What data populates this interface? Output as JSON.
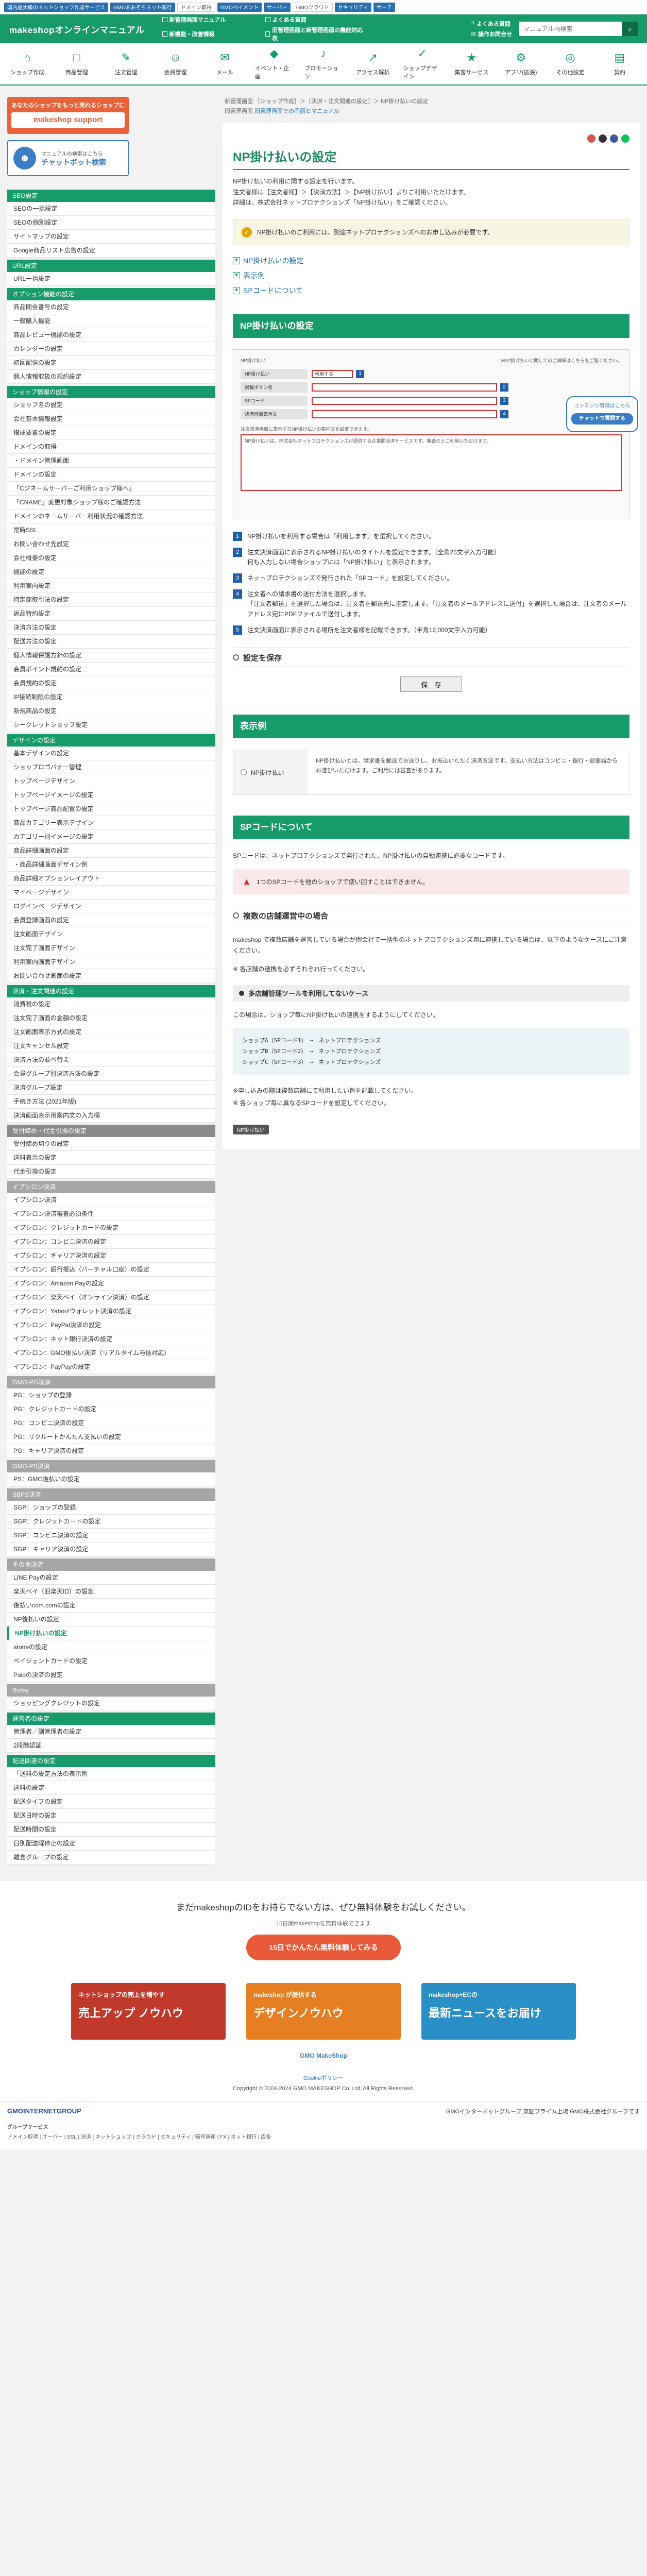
{
  "topbar": [
    "国内最大級のネットショップ作成サービス",
    "GMOあおぞらネット銀行",
    "ドメイン取得",
    "GMOペイメント",
    "サーバー",
    "GMOクラウド",
    "セキュリティ",
    "サーチ"
  ],
  "brand": "makeshopオンラインマニュアル",
  "news": [
    "新管理画面マニュアル",
    "よくある質問",
    "新機能・改善情報",
    "旧管理画面と新管理画面の機能対応表"
  ],
  "help": [
    "よくある質問",
    "操作お問合せ"
  ],
  "search_placeholder": "マニュアル内検索",
  "nav": [
    {
      "icon": "⌂",
      "label": "ショップ作成"
    },
    {
      "icon": "□",
      "label": "商品管理"
    },
    {
      "icon": "✎",
      "label": "注文管理"
    },
    {
      "icon": "☺",
      "label": "会員管理"
    },
    {
      "icon": "✉",
      "label": "メール"
    },
    {
      "icon": "◆",
      "label": "イベント・企画"
    },
    {
      "icon": "♪",
      "label": "プロモーション"
    },
    {
      "icon": "↗",
      "label": "アクセス解析"
    },
    {
      "icon": "✓",
      "label": "ショップデザイン"
    },
    {
      "icon": "★",
      "label": "集客サービス"
    },
    {
      "icon": "⚙",
      "label": "アプリ(拡張)"
    },
    {
      "icon": "◎",
      "label": "その他設定"
    },
    {
      "icon": "▤",
      "label": "契約"
    }
  ],
  "promo": {
    "line1": "あなたのショップをもっと売れるショップに",
    "line2": "makeshop support"
  },
  "chatbot": {
    "line1": "マニュアルの検索はこちら",
    "line2": "チャットボット検索"
  },
  "sidebar": [
    {
      "head": "SEO設定",
      "style": "green",
      "items": [
        "SEOの一括設定",
        "SEOの個別設定",
        "サイトマップの設定",
        "Google商品リスト広告の設定"
      ]
    },
    {
      "head": "URL設定",
      "style": "green",
      "items": [
        "URL一括設定"
      ]
    },
    {
      "head": "オプション機能の設定",
      "style": "green",
      "items": [
        "商品問合番号の設定",
        "一般購入機能",
        "商品レビュー機能の設定",
        "カレンダーの設定",
        "初回配信の設定",
        "個人情報取扱の規約設定"
      ]
    },
    {
      "head": "ショップ情報の設定",
      "style": "green",
      "items": [
        "ショップ名の設定",
        "会社基本情報設定",
        "構成要素の設定",
        "ドメインの取得",
        "・ドメイン管理画面",
        "ドメインの設定",
        "「Cジネームサーバーご利用ショップ様へ」",
        "「CNAME」変更対象ショップ様のご確認方法",
        "ドメインのネームサーバー利用状況の確認方法",
        "常時SSL",
        "お問い合わせ先設定",
        "会社概要の設定",
        "機能の設定",
        "利用案内設定",
        "特定商取引法の設定",
        "返品特約設定",
        "決済方法の設定",
        "配送方法の設定",
        "個人情報保護方針の設定",
        "会員ポイント規約の設定",
        "会員規約の設定",
        "IP接続制限の設定",
        "新規商品の設定",
        "シークレットショップ設定"
      ]
    },
    {
      "head": "デザインの設定",
      "style": "green",
      "items": [
        "基本デザインの設定",
        "ショップロゴバナー管理",
        "トップページデザイン",
        "トップページイメージの設定",
        "トップページ商品配置の設定",
        "商品カテゴリー表示デザイン",
        "カテゴリー別イメージの設定",
        "商品詳細画面の設定",
        "・商品詳細画面デザイン例",
        "商品詳細オプションレイアウト",
        "マイページデザイン",
        "ログインページデザイン",
        "会員登録画面の設定",
        "注文画面デザイン",
        "注文完了画面デザイン",
        "利用案内画面デザイン",
        "お問い合わせ画面の設定"
      ]
    },
    {
      "head": "決済・注文関連の設定",
      "style": "green",
      "items": [
        "消費税の設定",
        "注文完了画面の金額の設定",
        "注文画面表示方式の設定",
        "注文キャンセル設定",
        "決済方法の並べ替え",
        "会員グループ別決済方法の設定",
        "決済グループ設定",
        "手続き方法 (2021年版)",
        "決済画面表示用案内文の入力欄"
      ]
    },
    {
      "head": "受付締め・代金引換の設定",
      "style": "gray",
      "items": [
        "受付締め切りの設定",
        "送料表示の設定",
        "代金引換の設定"
      ]
    },
    {
      "head": "イプシロン決済",
      "style": "sub",
      "items": [
        "イプシロン決済",
        "イプシロン決済審査必須条件",
        "イプシロン：クレジットカードの設定",
        "イプシロン：コンビニ決済の設定",
        "イプシロン：キャリア決済の設定",
        "イプシロン：銀行振込（バーチャル口座）の設定",
        "イプシロン：Amazon Payの設定",
        "イプシロン：楽天ペイ（オンライン決済）の設定",
        "イプシロン：Yahoo!ウォレット決済の設定",
        "イプシロン：PayPal決済の設定",
        "イプシロン：ネット銀行決済の設定",
        "イプシロン：GMO後払い決済（リアルタイム与信対応）",
        "イプシロン：PayPayの設定"
      ]
    },
    {
      "head": "GMO-PG決済",
      "style": "sub",
      "items": [
        "PG：ショップの登録",
        "PG：クレジットカードの設定",
        "PG：コンビニ決済の設定",
        "PG：リクルートかんたん支払いの設定",
        "PG：キャリア決済の設定"
      ]
    },
    {
      "head": "GMO-PS決済",
      "style": "sub",
      "items": [
        "PS：GMO後払いの設定"
      ]
    },
    {
      "head": "SBPS決済",
      "style": "sub",
      "items": [
        "SGP：ショップの登録",
        "SGP：クレジットカードの設定",
        "SGP：コンビニ決済の設定",
        "SGP：キャリア決済の設定"
      ]
    },
    {
      "head": "その他決済",
      "style": "sub",
      "items": [
        "LINE Payの設定",
        "楽天ペイ（旧楽天ID）の設定",
        "後払いcom.comの設定",
        "NP後払いの設定",
        "NP掛け払いの設定",
        "atoneの設定",
        "ペイジェントカードの設定",
        "Paidの決済の設定"
      ]
    },
    {
      "head": "Bizley",
      "style": "sub",
      "items": [
        "ショッピングクレジットの設定"
      ]
    },
    {
      "head": "運営者の設定",
      "style": "green",
      "items": [
        "管理者／副管理者の設定",
        "2段階認証"
      ]
    },
    {
      "head": "配送関連の設定",
      "style": "green",
      "items": [
        "「送料の設定方法の表示例",
        "送料の設定",
        "配送タイプの設定",
        "配送日時の設定",
        "配送時間の設定",
        "日別配送曜停止の設定",
        "離島グループの設定"
      ]
    }
  ],
  "active_item": "NP掛け払いの設定",
  "breadcrumb": {
    "line1": "新管理画面 ［ショップ作成］＞［決済・注文関連の設定］＞ NP掛け払いの設定",
    "line2": "旧管理画面 ",
    "line2_link": "旧管理画面での画面とマニュアル"
  },
  "page_title": "NP掛け払いの設定",
  "lead": {
    "line1": "NP掛け払いの利用に関する設定を行います。",
    "line2": "注文者様は【注文者様】＞【決済方法】＞【NP掛け払い】よりご利用いただけます。",
    "line3": "詳細は、株式会社ネットプロテクションズ「NP掛け払い」をご確認ください。"
  },
  "notice": "NP掛け払いのご利用には、別途ネットプロテクションズへのお申し込みが必要です。",
  "toc": [
    "NP掛け払いの設定",
    "表示例",
    "SPコードについて"
  ],
  "section1": "NP掛け払いの設定",
  "shot": {
    "hdr_left": "NP掛け払い",
    "hdr_right": "※NP掛け払いに関してのご詳細はこちらをご覧ください。",
    "rows": [
      "NP掛け払い",
      "掲載ボタン名",
      "SPコード",
      "決済画面表示文"
    ],
    "select": "利用する",
    "note": "注文決済画面に表示するNP掛け払いの案内文を設定できます。",
    "textarea": "NP掛け払いは、株式会社ネットプロテクションズが提供する企業間決済サービスです。審査の上ご利用いただけます。",
    "widget_line1": "コンテンツ管理はこちら",
    "widget_line2": "チャットで質問する"
  },
  "steps": [
    "NP掛け払いを利用する場合は「利用します」を選択してください。",
    "注文決済画面に表示されるNP掛け払いのタイトルを設定できます。（全角25文字入力可能）\n何も入力しない場合ショップには「NP掛け払い」と表示されます。",
    "ネットプロテクションズで発行された「SPコード」を設定してください。",
    "注文者への請求書の送付方法を選択します。\n「注文者郵送」を選択した場合は、注文者を郵送先に指定します。「注文者のメールアドレスに送付」を選択した場合は、注文者のメールアドレス宛にPDFファイルで送付します。",
    "注文決済画面に表示される場所を注文者様を記載できます。（半角12,000文字入力可能）"
  ],
  "save_head": "設定を保存",
  "save_button": "保　存",
  "section2": "表示例",
  "example": {
    "label": "NP掛け払い",
    "desc": "NP掛け払いとは、請求書を郵送でお送りし、お振込いただく決済方法です。支払い方法はコンビニ・銀行・郵便局からお選びいただけます。ご利用には審査があります。"
  },
  "section3": "SPコードについて",
  "sp_para": "SPコードは、ネットプロテクションズで発行された、NP掛け払いの自動連携に必要なコードです。",
  "sp_warn": "1つのSPコードを他のショップで使い回すことはできません。",
  "multi_head": "複数の店舗運営中の場合",
  "multi_para": "makeshop で複数店舗を運営している場合が例会社で一括型のネットプロテクションズ用に連携している場合は、以下のようなケースにご注意ください。",
  "multi_para2": "※ 各店舗の連携を必ずそれぞれ行ってください。",
  "case_head": "多店舗管理ツールを利用してないケース",
  "case_para": "この場合は、ショップ毎にNP掛け払いの連携をするようにしてください。",
  "code_lines": [
    "ショップA（SPコード1）　→　ネットプロテクションズ",
    "ショップB（SPコード2）　→　ネットプロテクションズ",
    "ショップC（SPコード3）　→　ネットプロテクションズ"
  ],
  "case_note1": "※申し込みの際は複数店舗にて利用したい旨を記載してください。",
  "case_note2": "※ 各ショップ毎に異なるSPコードを設定してください。",
  "tag": "NP掛け払い",
  "cta": {
    "title": "まだmakeshopのIDをお持ちでない方は、ぜひ無料体験をお試しください。",
    "sub": "15日間makeshopを無料体験できます",
    "button": "15日でかんたん無料体験してみる"
  },
  "banners": [
    {
      "top": "ネットショップの売上を増やす",
      "main": "売上アップ ノウハウ",
      "color": "#c0392b"
    },
    {
      "top": "makeshop が提供する",
      "main": "デザインノウハウ",
      "color": "#e67e22"
    },
    {
      "top": "makeshop+ECの",
      "main": "最新ニュースをお届け",
      "color": "#2a8fc7"
    }
  ],
  "footer_logo": "GMO MakeShop",
  "copyright_top": "Cookieポリシー",
  "copyright": "Copyright © 2004-2024 GMO MAKESHOP Co. Ltd. All Rights Reserved.",
  "gmo_logo": "GMOINTERNETGROUP",
  "gmo_right": "GMOインターネットグループ 東証プライム上場 GMO株式会社グループです",
  "group_title": "グループサービス",
  "group_links": "ドメイン取得 | サーバー | SSL | 決済 | ネットショップ | クラウド | セキュリティ | 暗号資産 | FX | ネット銀行 | 広告"
}
